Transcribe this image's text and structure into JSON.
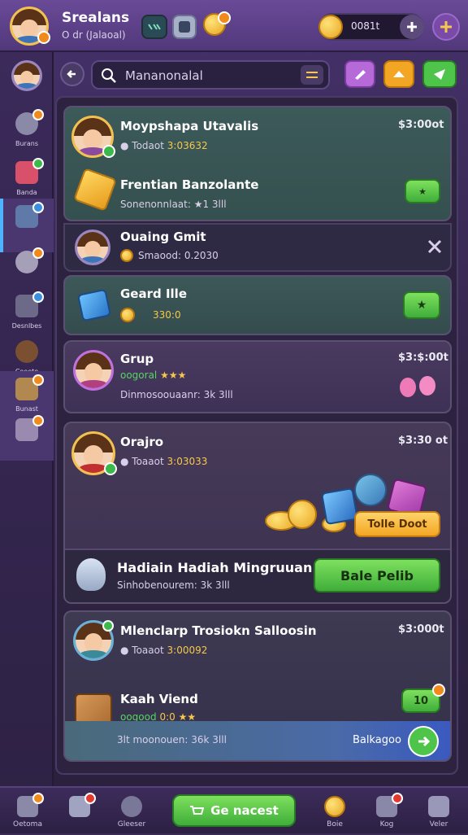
{
  "header": {
    "title": "Srealans",
    "subtitle": "O dr (Jalaoal)",
    "coins": "0081t",
    "icons": [
      "chat-icon",
      "save-icon",
      "coin-reward-icon",
      "add-icon",
      "plus-icon"
    ]
  },
  "sidebar": {
    "items": [
      {
        "label": ""
      },
      {
        "label": "Burans"
      },
      {
        "label": "Banda"
      },
      {
        "label": ""
      },
      {
        "label": ""
      },
      {
        "label": "Desnlbes"
      },
      {
        "label": "Cooete"
      },
      {
        "label": "Bunast"
      },
      {
        "label": ""
      }
    ]
  },
  "search": {
    "value": "Mananonalal"
  },
  "cards": [
    {
      "title": "Moypshapa Utavalis",
      "sub_prefix": "Todaot",
      "sub_value": "3:03632",
      "price": "$3:00ot"
    },
    {
      "title": "Frentian Banzolante",
      "sub": "Sonenonnlaat: ★1 3lll"
    },
    {
      "title": "Ouaing Gmit",
      "sub": "Smaood: 0.2030"
    },
    {
      "title": "Geard Ille",
      "sub": "330:0"
    },
    {
      "title": "Grup",
      "sub_green": "oogoral",
      "sub": "Dinmosoouaanr: 3k 3lll",
      "price": "$3:$:00t"
    },
    {
      "title": "Orajro",
      "sub_prefix": "Toaaot",
      "sub_value": "3:03033",
      "price": "$3:30 ot",
      "reward_label": "Tolle Doot"
    },
    {
      "title": "Hadiain Hadiah Mingruuan",
      "sub": "Sinhobenourem: 3k 3lll",
      "button": "Bale Pelib"
    },
    {
      "title": "Mlenclarp Trosiokn Salloosin",
      "sub_prefix": "Toaaot",
      "sub_value": "3:00092",
      "price": "$3:000t"
    },
    {
      "title": "Kaah Viend",
      "sub_green": "oogood",
      "sub_gold": "0:0",
      "sub": "3lt moonouen: 36k 3lll",
      "mini": "10",
      "link": "Balkagoo"
    }
  ],
  "bottom_nav": {
    "items": [
      "Oetoma",
      "",
      "Gleeser",
      "Boie",
      "Kog",
      "Veler"
    ],
    "primary": "Ge nacest"
  },
  "colors": {
    "accent_purple": "#51387a",
    "accent_green": "#4fc44a",
    "accent_gold": "#f3a623"
  }
}
